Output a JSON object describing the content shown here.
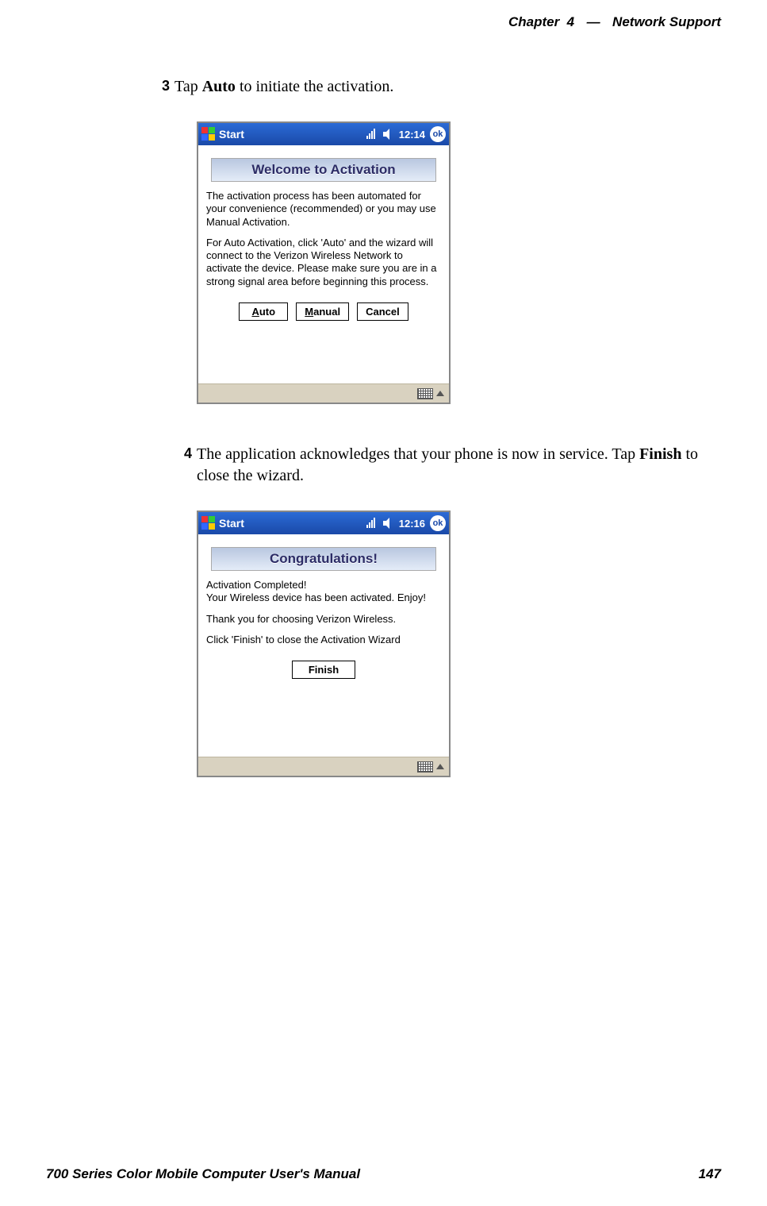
{
  "header": {
    "chapter_label": "Chapter",
    "chapter_num": "4",
    "sep": "—",
    "chapter_title": "Network Support"
  },
  "steps": {
    "s3": {
      "num": "3",
      "pre": "Tap ",
      "bold": "Auto",
      "post": " to initiate the activation."
    },
    "s4": {
      "num": "4",
      "line": "The application acknowledges that your phone is now in service. Tap ",
      "bold": "Finish",
      "post": " to close the wizard."
    }
  },
  "shot1": {
    "start": "Start",
    "time": "12:14",
    "ok": "ok",
    "banner": "Welcome to Activation",
    "p1": "The activation process has been automated for your convenience (recommended) or you may use Manual Activation.",
    "p2": "For Auto Activation, click 'Auto' and the wizard will connect to the Verizon Wireless Network to activate the device.  Please make sure you are in a strong signal area before beginning this process.",
    "btn_auto_u": "A",
    "btn_auto_r": "uto",
    "btn_manual_u": "M",
    "btn_manual_r": "anual",
    "btn_cancel": "Cancel"
  },
  "shot2": {
    "start": "Start",
    "time": "12:16",
    "ok": "ok",
    "banner": "Congratulations!",
    "p1": "Activation Completed!\nYour Wireless device has been activated.  Enjoy!",
    "p2": "Thank you for choosing Verizon Wireless.",
    "p3": " Click 'Finish' to close the Activation Wizard",
    "btn_finish": "Finish"
  },
  "footer": {
    "manual": "700 Series Color Mobile Computer User's Manual",
    "page": "147"
  }
}
